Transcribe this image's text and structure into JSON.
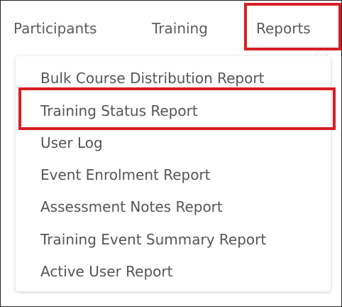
{
  "nav": {
    "items": [
      {
        "label": "Participants"
      },
      {
        "label": "Training"
      },
      {
        "label": "Reports"
      }
    ]
  },
  "reports_menu": {
    "items": [
      {
        "label": "Bulk Course Distribution Report"
      },
      {
        "label": "Training Status Report"
      },
      {
        "label": "User Log"
      },
      {
        "label": "Event Enrolment Report"
      },
      {
        "label": "Assessment Notes Report"
      },
      {
        "label": "Training Event Summary Report"
      },
      {
        "label": "Active User Report"
      }
    ]
  },
  "colors": {
    "highlight": "#d81e25",
    "nav_text": "#5b5b5b",
    "menu_text": "#555555"
  }
}
